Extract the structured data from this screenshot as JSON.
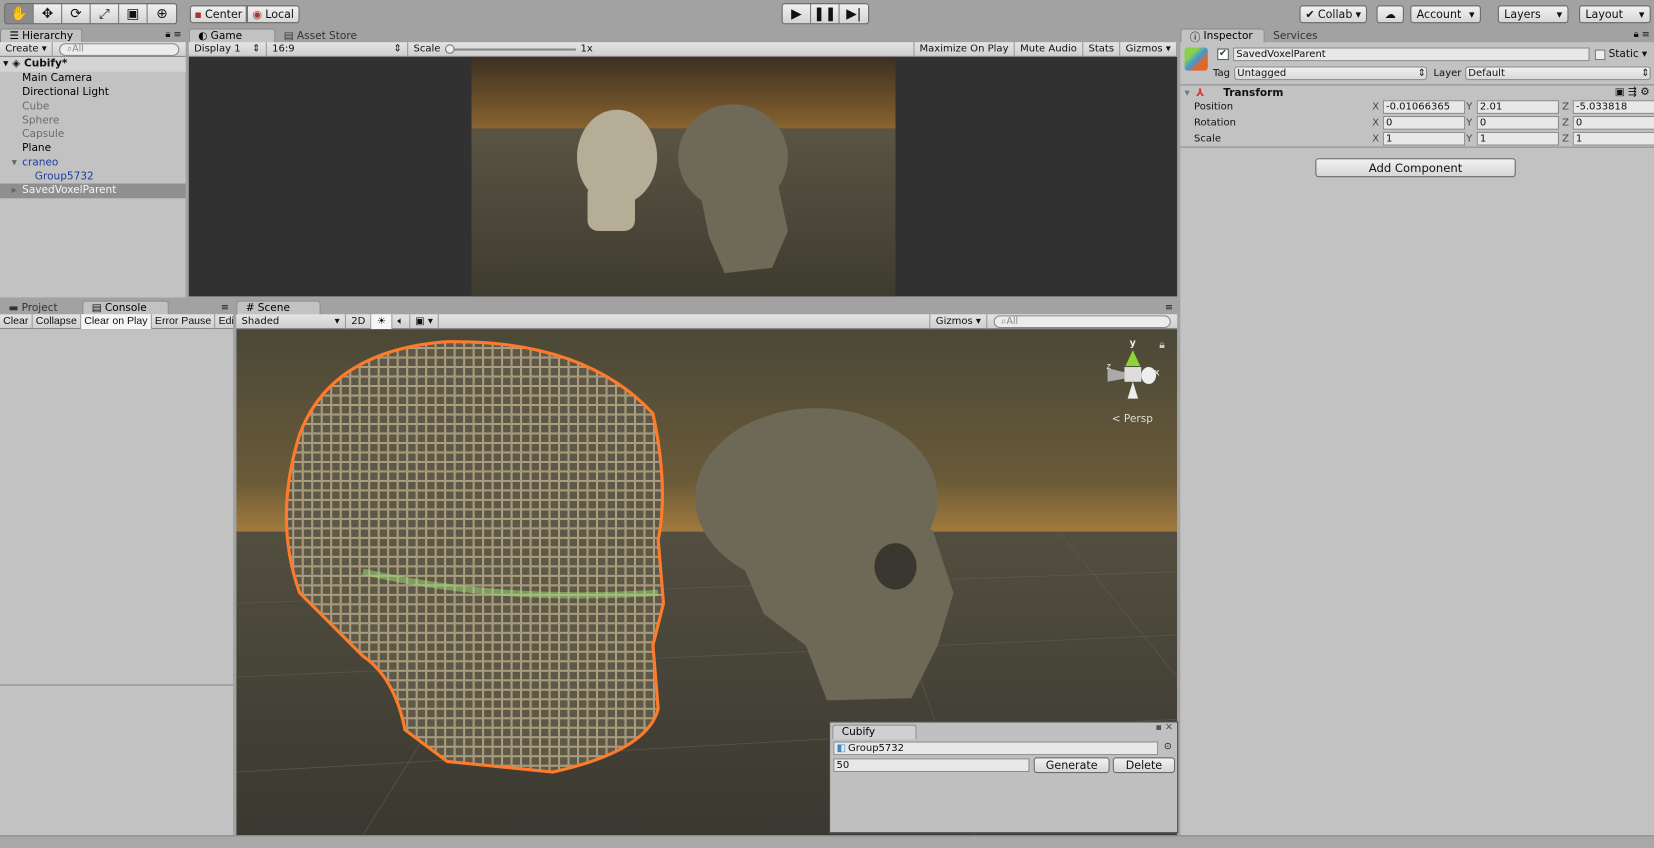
{
  "toolbar": {
    "tools": [
      "hand-icon",
      "move-icon",
      "rotate-icon",
      "scale-icon",
      "rect-icon",
      "transform-icon"
    ],
    "pivot": "Center",
    "space": "Local",
    "play": "play-icon",
    "pause": "pause-icon",
    "step": "step-icon",
    "collab": "Collab",
    "account": "Account",
    "layers": "Layers",
    "layout": "Layout"
  },
  "hierarchy": {
    "tab": "Hierarchy",
    "create": "Create",
    "search_placeholder": "All",
    "scene": "Cubify*",
    "items": [
      {
        "label": "Main Camera",
        "state": "active"
      },
      {
        "label": "Directional Light",
        "state": "active"
      },
      {
        "label": "Cube",
        "state": "inactive"
      },
      {
        "label": "Sphere",
        "state": "inactive"
      },
      {
        "label": "Capsule",
        "state": "inactive"
      },
      {
        "label": "Plane",
        "state": "active"
      },
      {
        "label": "craneo",
        "state": "prefab"
      },
      {
        "label": "Group5732",
        "state": "prefab"
      },
      {
        "label": "SavedVoxelParent",
        "state": "selected"
      }
    ]
  },
  "game": {
    "tab": "Game",
    "tab2": "Asset Store",
    "display": "Display 1",
    "aspect": "16:9",
    "scale_label": "Scale",
    "scale_value": "1x",
    "maximize": "Maximize On Play",
    "mute": "Mute Audio",
    "stats": "Stats",
    "gizmos": "Gizmos"
  },
  "console": {
    "tab_project": "Project",
    "tab_console": "Console",
    "clear": "Clear",
    "collapse": "Collapse",
    "clear_on_play": "Clear on Play",
    "error_pause": "Error Pause",
    "editor": "Edi"
  },
  "scene": {
    "tab": "Scene",
    "shading": "Shaded",
    "mode2d": "2D",
    "gizmos": "Gizmos",
    "search_placeholder": "All",
    "persp": "Persp",
    "axis_y": "y",
    "axis_x": "x",
    "axis_z": "z"
  },
  "inspector": {
    "tab": "Inspector",
    "tab2": "Services",
    "object_name": "SavedVoxelParent",
    "active": true,
    "static_label": "Static",
    "static": false,
    "tag_label": "Tag",
    "tag": "Untagged",
    "layer_label": "Layer",
    "layer": "Default",
    "component": "Transform",
    "rows": [
      {
        "label": "Position",
        "x": "-0.01066365",
        "y": "2.01",
        "z": "-5.033818"
      },
      {
        "label": "Rotation",
        "x": "0",
        "y": "0",
        "z": "0"
      },
      {
        "label": "Scale",
        "x": "1",
        "y": "1",
        "z": "1"
      }
    ],
    "axis": {
      "x": "X",
      "y": "Y",
      "z": "Z"
    },
    "add_component": "Add Component"
  },
  "cubify": {
    "tab": "Cubify",
    "object": "Group5732",
    "value": "50",
    "generate": "Generate",
    "delete": "Delete"
  },
  "colors": {
    "selection": "#8f8f8f",
    "prefab_text": "#1b3fa0",
    "voxel_outline": "#ff7a2a",
    "voxel_inner": "#9fe07a"
  }
}
